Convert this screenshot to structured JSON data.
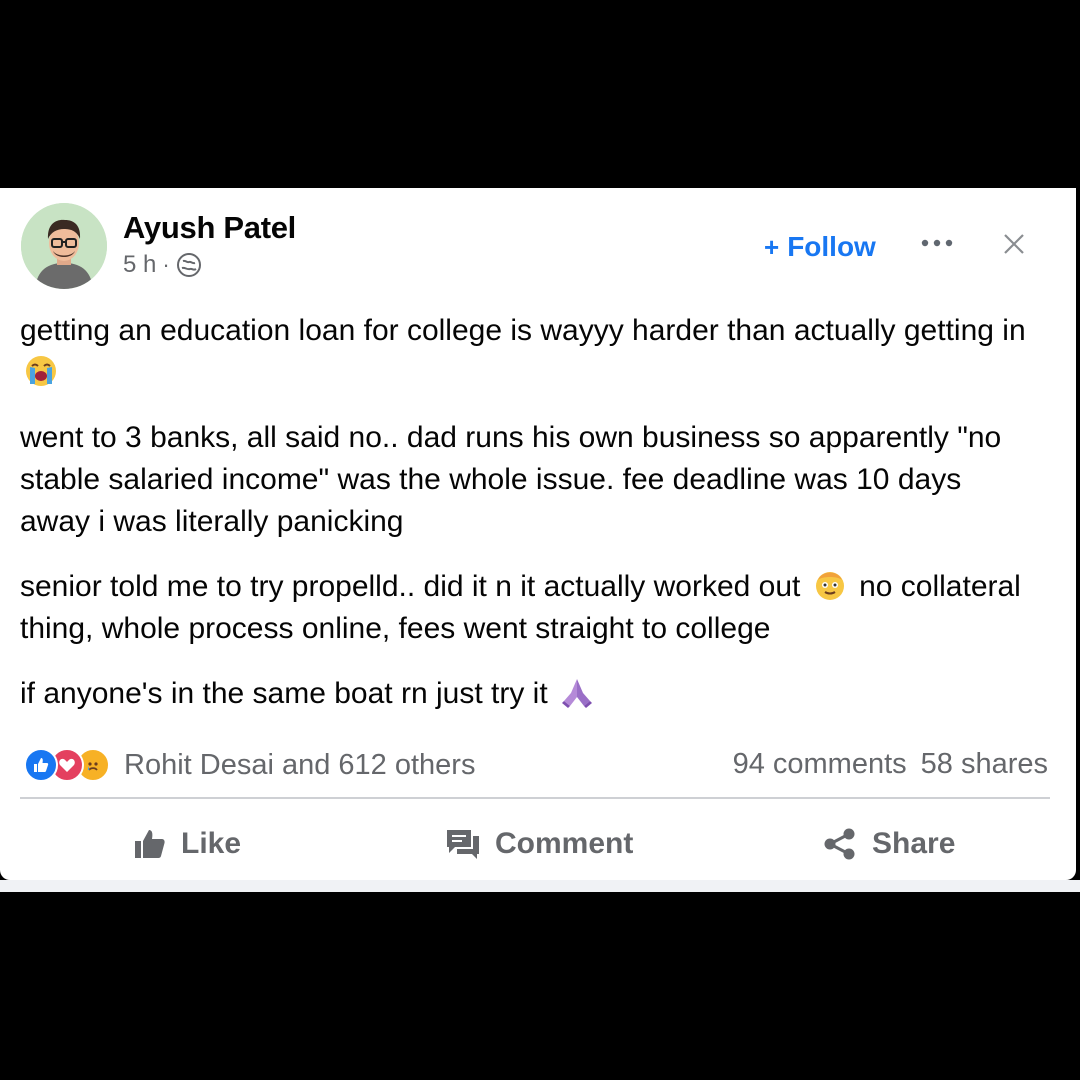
{
  "post": {
    "author": "Ayush Patel",
    "time": "5 h",
    "audience_icon": "globe-icon",
    "follow_label": "Follow",
    "paragraphs": [
      {
        "text": "getting an education loan for college is wayyy harder than actually getting in",
        "emoji": "loudly-crying-face"
      },
      {
        "text": "went to 3 banks, all said no.. dad runs his own business so apparently \"no stable salaried income\" was the whole issue. fee deadline was 10 days away i was literally panicking",
        "emoji": ""
      },
      {
        "text_a": "senior told me to try propelld.. did it n it actually worked out",
        "emoji": "relieved-face",
        "text_b": "no collateral thing, whole process online, fees went straight to college"
      },
      {
        "text": "if anyone's in the same boat rn just try it",
        "emoji": "folded-hands"
      }
    ],
    "reactions": {
      "icons": [
        "like-icon",
        "love-icon",
        "sad-icon"
      ],
      "names": "Rohit Desai and 612 others"
    },
    "comments": "94 comments",
    "shares": "58 shares",
    "actions": {
      "like": "Like",
      "comment": "Comment",
      "share": "Share"
    },
    "colors": {
      "accent": "#1877f2",
      "secondary_text": "#65676b",
      "primary_text": "#050505"
    }
  }
}
